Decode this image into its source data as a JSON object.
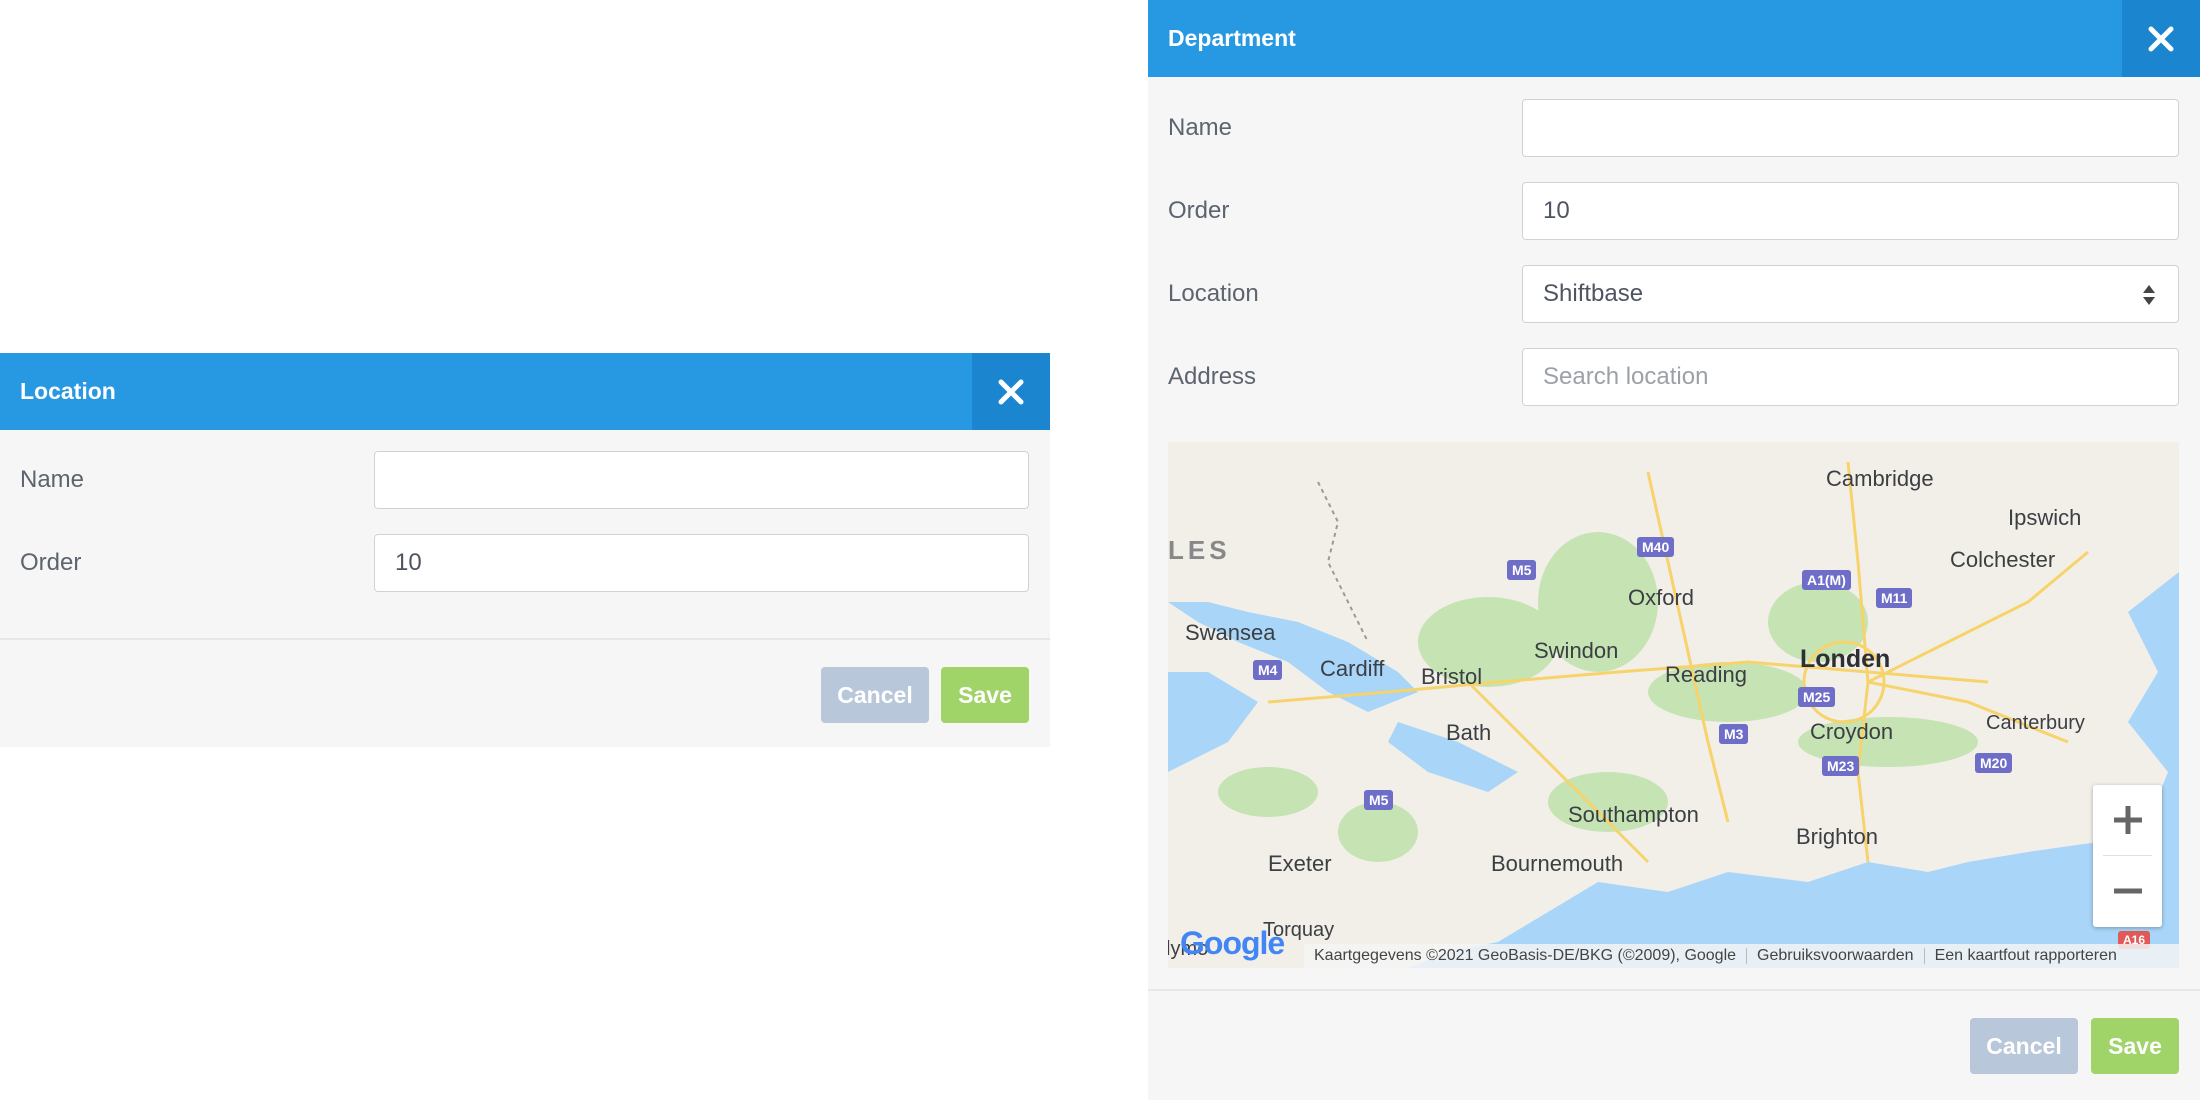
{
  "location_dialog": {
    "title": "Location",
    "fields": {
      "name_label": "Name",
      "name_value": "",
      "order_label": "Order",
      "order_value": "10"
    },
    "cancel_label": "Cancel",
    "save_label": "Save"
  },
  "department_dialog": {
    "title": "Department",
    "fields": {
      "name_label": "Name",
      "name_value": "",
      "order_label": "Order",
      "order_value": "10",
      "location_label": "Location",
      "location_value": "Shiftbase",
      "address_label": "Address",
      "address_placeholder": "Search location"
    },
    "map": {
      "region_label": "LES",
      "cities": [
        "Cambridge",
        "Ipswich",
        "Colchester",
        "Oxford",
        "Swansea",
        "Cardiff",
        "Bristol",
        "Swindon",
        "Reading",
        "Londen",
        "Bath",
        "Croydon",
        "Canterbury",
        "Southampton",
        "Brighton",
        "Exeter",
        "Bournemouth",
        "Torquay",
        "lymo"
      ],
      "roads": [
        "M40",
        "M5",
        "A1(M)",
        "M11",
        "M4",
        "M25",
        "M3",
        "M23",
        "M20",
        "M5",
        "A16"
      ],
      "zoom_in": "+",
      "zoom_out": "−",
      "google_logo": "Google",
      "attribution": "Kaartgegevens ©2021 GeoBasis-DE/BKG (©2009), Google",
      "terms": "Gebruiksvoorwaarden",
      "report": "Een kaartfout rapporteren"
    },
    "cancel_label": "Cancel",
    "save_label": "Save"
  },
  "colors": {
    "header": "#2799e2",
    "close_bg": "#1b86cf",
    "cancel": "#b9c7db",
    "save": "#a0d468",
    "panel_bg": "#f6f6f6",
    "water": "#a8d5f8",
    "land": "#f2efe9",
    "park": "#c6e3b4"
  }
}
